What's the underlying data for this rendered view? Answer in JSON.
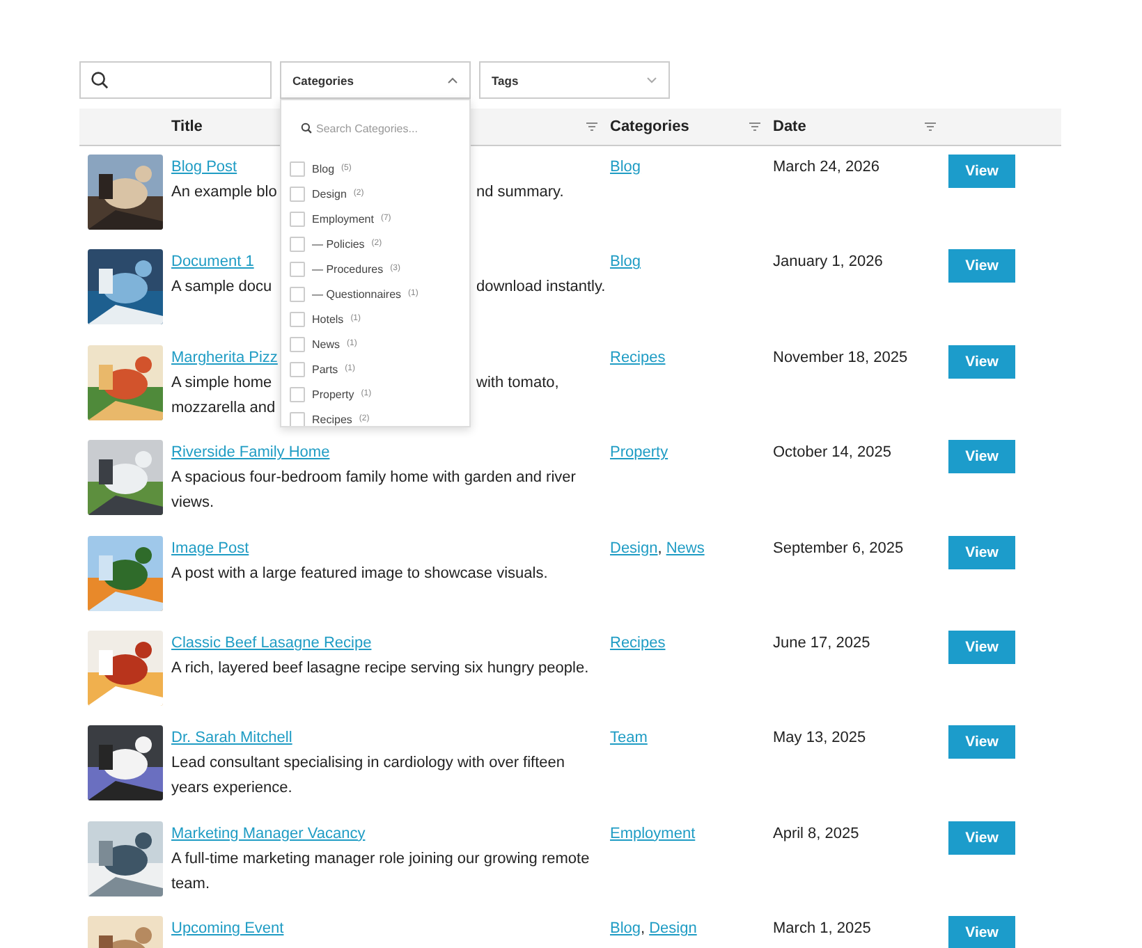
{
  "filters": {
    "selects": [
      {
        "label": "Categories",
        "expanded": true
      },
      {
        "label": "Tags",
        "expanded": false
      }
    ]
  },
  "category_dropdown": {
    "placeholder": "Search Categories...",
    "items": [
      {
        "label": "Blog",
        "count": "(5)",
        "checked": false
      },
      {
        "label": "Design",
        "count": "(2)",
        "checked": false
      },
      {
        "label": "Employment",
        "count": "(7)",
        "checked": false,
        "children": [
          {
            "label": "— Policies",
            "count": "(2)",
            "checked": false
          },
          {
            "label": "— Procedures",
            "count": "(3)",
            "checked": false
          },
          {
            "label": "— Questionnaires",
            "count": "(1)",
            "checked": false
          }
        ]
      },
      {
        "label": "Hotels",
        "count": "(1)",
        "checked": false
      },
      {
        "label": "News",
        "count": "(1)",
        "checked": false
      },
      {
        "label": "Parts",
        "count": "(1)",
        "checked": false
      },
      {
        "label": "Property",
        "count": "(1)",
        "checked": false
      },
      {
        "label": "Recipes",
        "count": "(2)",
        "checked": false
      }
    ]
  },
  "table": {
    "columns": [
      {
        "label": "Title"
      },
      {
        "label": "Categories"
      },
      {
        "label": "Date"
      }
    ],
    "rows": [
      {
        "image": {
          "kind": "picture"
        },
        "title": "Blog Post",
        "description_lines": [
          [
            "An example blo",
            "nd summary."
          ]
        ],
        "categories": [
          {
            "label": "Blog"
          }
        ],
        "date": "March 24, 2026",
        "action": "View"
      },
      {
        "image": {
          "kind": "picture"
        },
        "title": "Document 1",
        "description_lines": [
          [
            "A sample docu",
            "download instantly."
          ]
        ],
        "categories": [
          {
            "label": "Blog"
          }
        ],
        "date": "January 1, 2026",
        "action": "View"
      },
      {
        "image": {
          "kind": "picture"
        },
        "title": "Margherita Pizz",
        "description_lines": [
          [
            "A simple home",
            "with tomato,"
          ],
          [
            "mozzarella and"
          ]
        ],
        "categories": [
          {
            "label": "Recipes"
          }
        ],
        "date": "November 18, 2025",
        "action": "View"
      },
      {
        "image": {
          "kind": "picture"
        },
        "title": "Riverside Family Home",
        "description": "A spacious four-bedroom family home with garden and river views.",
        "categories": [
          {
            "label": "Property"
          }
        ],
        "date": "October 14, 2025",
        "action": "View"
      },
      {
        "image": {
          "kind": "picture"
        },
        "title": "Image Post",
        "description": "A post with a large featured image to showcase visuals.",
        "categories": [
          {
            "label": "Design",
            "sep": ","
          },
          {
            "label": "News"
          }
        ],
        "date": "September 6, 2025",
        "action": "View"
      },
      {
        "image": {
          "kind": "picture"
        },
        "title": "Classic Beef Lasagne Recipe",
        "description": "A rich, layered beef lasagne recipe serving six hungry people.",
        "categories": [
          {
            "label": "Recipes"
          }
        ],
        "date": "June 17, 2025",
        "action": "View"
      },
      {
        "image": {
          "kind": "picture"
        },
        "title": "Dr. Sarah Mitchell",
        "description": "Lead consultant specialising in cardiology with over fifteen years experience.",
        "categories": [
          {
            "label": "Team"
          }
        ],
        "date": "May 13, 2025",
        "action": "View"
      },
      {
        "image": {
          "kind": "picture"
        },
        "title": "Marketing Manager Vacancy",
        "description": "A full-time marketing manager role joining our growing remote team.",
        "categories": [
          {
            "label": "Employment"
          }
        ],
        "date": "April 8, 2025",
        "action": "View"
      },
      {
        "image": {
          "kind": "picture"
        },
        "title": "Upcoming Event",
        "categories": [
          {
            "label": "Blog",
            "sep": ","
          },
          {
            "label": "Design"
          }
        ],
        "date": "March 1, 2025",
        "action": "View"
      }
    ]
  }
}
